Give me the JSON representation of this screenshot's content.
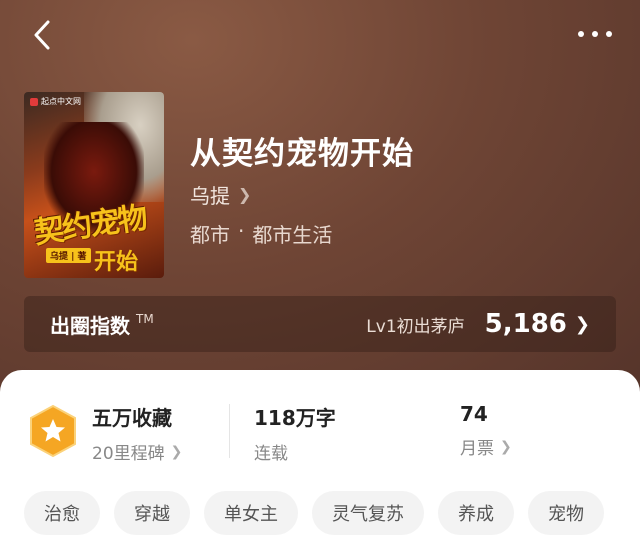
{
  "header": {
    "back_icon": "chevron-left-icon",
    "more_icon": "more-dots-icon"
  },
  "book": {
    "title": "从契约宠物开始",
    "author": "乌提",
    "genre": [
      "都市",
      "·",
      "都市生活"
    ],
    "cover": {
      "publisher": "起点中文网",
      "title_line1": "契约宠物",
      "title_line2": "开始",
      "author_tag": "乌提 | 著"
    }
  },
  "index": {
    "label": "出圈指数",
    "tm": "TM",
    "level": "Lv1初出茅庐",
    "score": "5,186"
  },
  "stats": {
    "collect": {
      "main": "五万收藏",
      "sub": "20里程碑"
    },
    "words": {
      "main": "118万字",
      "sub": "连载"
    },
    "tickets": {
      "main": "74",
      "sub": "月票"
    }
  },
  "tags": [
    "治愈",
    "穿越",
    "单女主",
    "灵气复苏",
    "养成",
    "宠物"
  ],
  "colors": {
    "hero": "#6f4535",
    "badge": "#f5a623",
    "accent": "#f7c21b"
  }
}
